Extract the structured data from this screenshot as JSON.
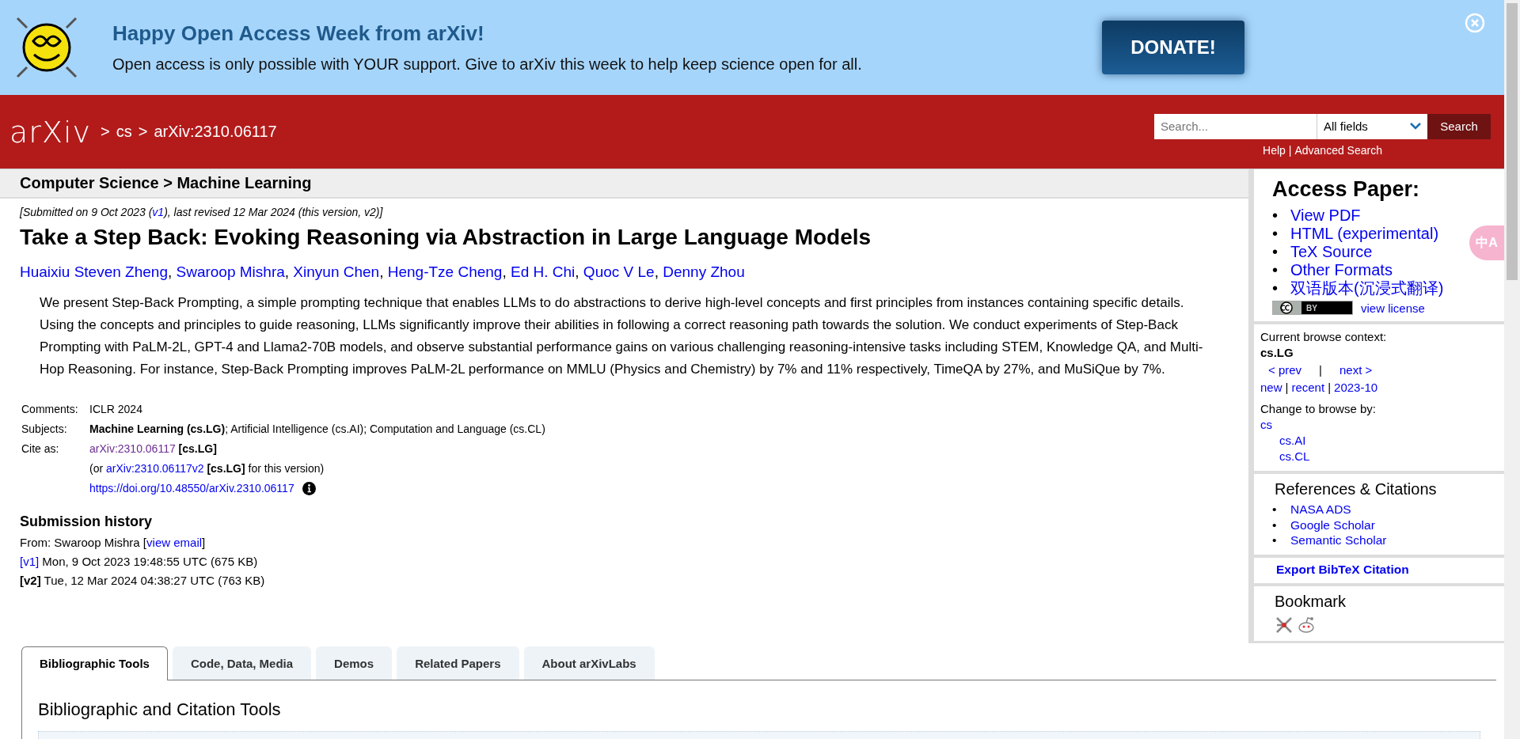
{
  "banner": {
    "title": "Happy Open Access Week from arXiv!",
    "message": "Open access is only possible with YOUR support. Give to arXiv this week to help keep science open for all.",
    "button": "DONATE!"
  },
  "header": {
    "logo": "arXiv",
    "breadcrumb": [
      {
        "separator": ">",
        "label": "cs"
      },
      {
        "separator": ">",
        "label": "arXiv:2310.06117"
      }
    ],
    "search": {
      "placeholder": "Search...",
      "field": "All fields",
      "button": "Search"
    },
    "help_links": [
      {
        "label": "Help"
      },
      {
        "separator": "|",
        "label": "Advanced Search"
      }
    ]
  },
  "category_bar": "Computer Science > Machine Learning",
  "dateline": {
    "before": "[Submitted on 9 Oct 2023 (",
    "link": "v1",
    "after": "), last revised 12 Mar 2024 (this version, v2)]"
  },
  "title": "Take a Step Back: Evoking Reasoning via Abstraction in Large Language Models",
  "authors": [
    {
      "name": "Huaixiu Steven Zheng",
      "separator": ","
    },
    {
      "name": "Swaroop Mishra",
      "separator": ","
    },
    {
      "name": "Xinyun Chen",
      "separator": ","
    },
    {
      "name": "Heng-Tze Cheng",
      "separator": ","
    },
    {
      "name": "Ed H. Chi",
      "separator": ","
    },
    {
      "name": "Quoc V Le",
      "separator": ","
    },
    {
      "name": "Denny Zhou"
    }
  ],
  "abstract": "We present Step-Back Prompting, a simple prompting technique that enables LLMs to do abstractions to derive high-level concepts and first principles from instances containing specific details. Using the concepts and principles to guide reasoning, LLMs significantly improve their abilities in following a correct reasoning path towards the solution. We conduct experiments of Step-Back Prompting with PaLM-2L, GPT-4 and Llama2-70B models, and observe substantial performance gains on various challenging reasoning-intensive tasks including STEM, Knowledge QA, and Multi-Hop Reasoning. For instance, Step-Back Prompting improves PaLM-2L performance on MMLU (Physics and Chemistry) by 7% and 11% respectively, TimeQA by 27%, and MuSiQue by 7%.",
  "metadata": [
    {
      "label": "Comments:",
      "value": "ICLR 2024"
    },
    {
      "label": "Subjects:",
      "value": "**Machine Learning (cs.LG)**; Artificial Intelligence (cs.AI); Computation and Language (cs.CL)"
    }
  ],
  "cite_as": {
    "label": "Cite as:",
    "id": "arXiv:2310.06117",
    "tag": "[cs.LG]",
    "alt_before": "(or ",
    "alt_id": "arXiv:2310.06117v2",
    "alt_after": " **[cs.LG]** for this version)",
    "doi": "https://doi.org/10.48550/arXiv.2310.06117"
  },
  "submission_history": {
    "title": "Submission history",
    "from_before": "From: Swaroop Mishra [",
    "from_link": "view email",
    "from_after": "]",
    "versions": [
      {
        "label": "[v1]",
        "current": false,
        "text": "Mon, 9 Oct 2023 19:48:55 UTC (675 KB)"
      },
      {
        "label": "[v2]",
        "current": true,
        "text": "Tue, 12 Mar 2024 04:38:27 UTC (763 KB)"
      }
    ]
  },
  "tabs": [
    {
      "label": "Bibliographic Tools",
      "selected": true
    },
    {
      "label": "Code, Data, Media",
      "selected": false
    },
    {
      "label": "Demos",
      "selected": false
    },
    {
      "label": "Related Papers",
      "selected": false
    },
    {
      "label": "About arXivLabs",
      "selected": false
    }
  ],
  "panel_title": "Bibliographic and Citation Tools",
  "sidebar": {
    "access": {
      "title": "Access Paper:",
      "links": [
        {
          "bullet": "•",
          "label": "View PDF"
        },
        {
          "bullet": "•",
          "label": "HTML (experimental)"
        },
        {
          "bullet": "•",
          "label": "TeX Source"
        },
        {
          "bullet": "•",
          "label": "Other Formats"
        },
        {
          "bullet": "•",
          "label": "双语版本(沉浸式翻译)"
        }
      ],
      "license_badge": "BY",
      "license_link": "view license"
    },
    "browse": {
      "context_label": "Current browse context:",
      "context": "cs.LG",
      "prev": "< prev",
      "nav_separator": "|",
      "next": "next >",
      "links": [
        {
          "label": "new"
        },
        {
          "separator": "|",
          "label": "recent"
        },
        {
          "separator": "|",
          "label": "2023-10"
        }
      ],
      "change_label": "Change to browse by:",
      "tree": [
        {
          "label": "cs",
          "children": [
            {
              "label": "cs.AI"
            },
            {
              "label": "cs.CL"
            }
          ]
        }
      ]
    },
    "references": {
      "title": "References & Citations",
      "links": [
        {
          "bullet": "•",
          "label": "NASA ADS"
        },
        {
          "bullet": "•",
          "label": "Google Scholar"
        },
        {
          "bullet": "•",
          "label": "Semantic Scholar"
        }
      ]
    },
    "export": "Export BibTeX Citation",
    "bookmark": {
      "title": "Bookmark"
    }
  },
  "translate_button": "中A"
}
